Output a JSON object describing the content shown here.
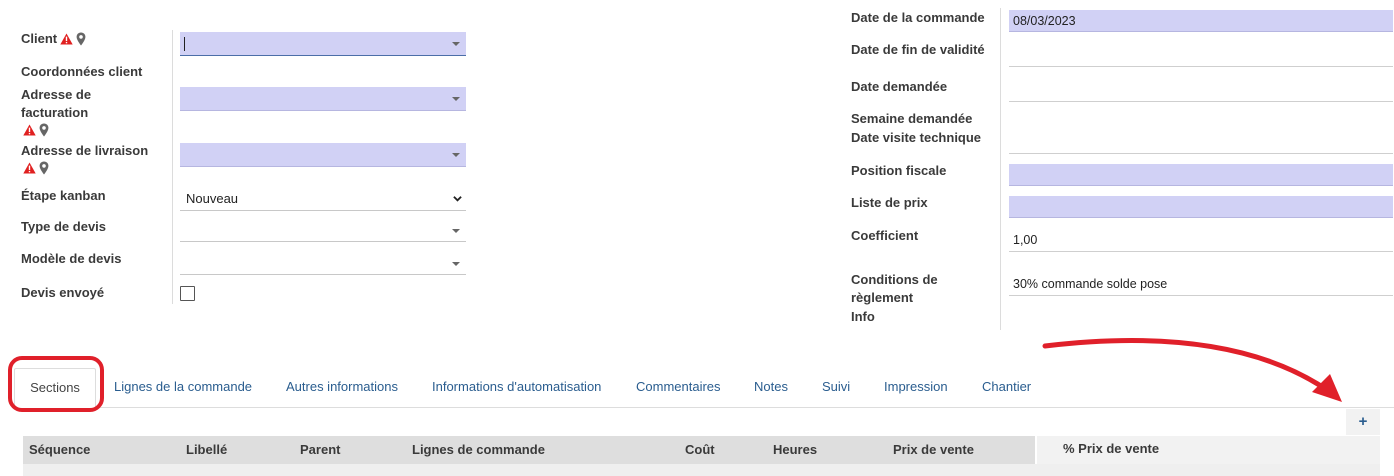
{
  "left_form": {
    "client_label": "Client",
    "coords_label": "Coordonnées client",
    "billing_label": "Adresse de facturation",
    "delivery_label": "Adresse de livraison",
    "kanban_label": "Étape kanban",
    "kanban_value": "Nouveau",
    "quote_type_label": "Type de devis",
    "quote_model_label": "Modèle de devis",
    "quote_sent_label": "Devis envoyé"
  },
  "right_form": {
    "order_date_label": "Date de la commande",
    "order_date_value": "08/03/2023",
    "validity_end_label": "Date de fin de validité",
    "requested_date_label": "Date demandée",
    "requested_week_label": "Semaine demandée",
    "tech_visit_label": "Date visite technique",
    "fiscal_position_label": "Position fiscale",
    "price_list_label": "Liste de prix",
    "coefficient_label": "Coefficient",
    "coefficient_value": "1,00",
    "payment_terms_label": "Conditions de règlement",
    "payment_terms_value": "30% commande solde pose",
    "info_label": "Info"
  },
  "tabs": [
    {
      "label": "Sections"
    },
    {
      "label": "Lignes de la commande"
    },
    {
      "label": "Autres informations"
    },
    {
      "label": "Informations d'automatisation"
    },
    {
      "label": "Commentaires"
    },
    {
      "label": "Notes"
    },
    {
      "label": "Suivi"
    },
    {
      "label": "Impression"
    },
    {
      "label": "Chantier"
    }
  ],
  "add_button": "+",
  "table": {
    "columns": [
      "Séquence",
      "Libellé",
      "Parent",
      "Lignes de commande",
      "Coût",
      "Heures",
      "Prix de vente",
      "% Prix de vente"
    ]
  },
  "colors": {
    "required_field": "#d1d1f5",
    "link": "#2a5d8f",
    "annotation_red": "#e0202a",
    "warning": "#e02020"
  }
}
